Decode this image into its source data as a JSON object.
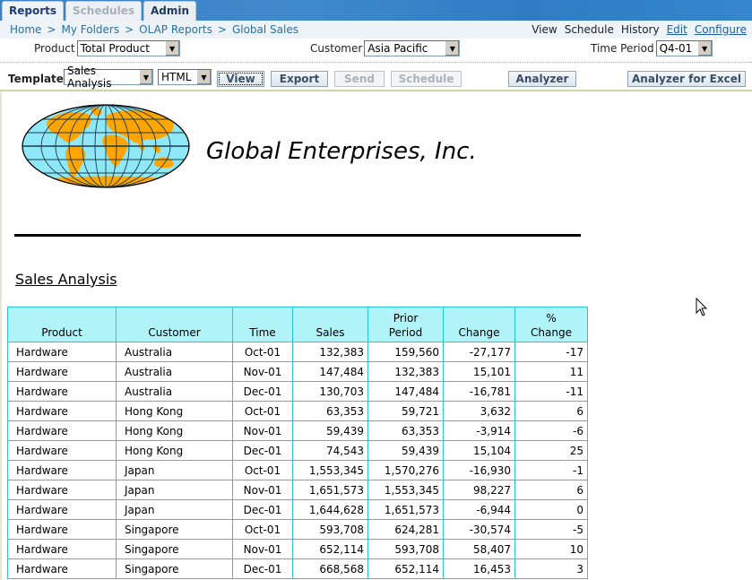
{
  "tabs": [
    {
      "label": "Reports",
      "state": "active"
    },
    {
      "label": "Schedules",
      "state": "inactive"
    },
    {
      "label": "Admin",
      "state": "normal"
    }
  ],
  "breadcrumb": [
    "Home",
    "My Folders",
    "OLAP Reports",
    "Global Sales"
  ],
  "breadcrumb_sep": ">",
  "actions": {
    "view": "View",
    "schedule": "Schedule",
    "history": "History",
    "edit": "Edit",
    "configure": "Configure"
  },
  "params": {
    "product": {
      "label": "Product",
      "value": "Total Product"
    },
    "customer": {
      "label": "Customer",
      "value": "Asia Pacific"
    },
    "time_period": {
      "label": "Time Period",
      "value": "Q4-01"
    }
  },
  "toolbar": {
    "template_label": "Template",
    "template_value": "Sales Analysis",
    "format_value": "HTML",
    "view": "View",
    "export": "Export",
    "send": "Send",
    "schedule": "Schedule",
    "analyzer": "Analyzer",
    "analyzer_excel": "Analyzer for Excel"
  },
  "report": {
    "company": "Global Enterprises, Inc.",
    "title": "Sales Analysis",
    "logo_icon": "globe-icon",
    "colors": {
      "header_bg": "#b0f4fa",
      "border": "#22c8e0",
      "logo_land": "#ffa500",
      "logo_ocean": "#8ee8f8"
    },
    "columns": [
      "Product",
      "Customer",
      "Time",
      "Sales",
      "Prior Period",
      "Change",
      "% Change"
    ],
    "rows": [
      [
        "Hardware",
        "Australia",
        "Oct-01",
        "132,383",
        "159,560",
        "-27,177",
        "-17"
      ],
      [
        "Hardware",
        "Australia",
        "Nov-01",
        "147,484",
        "132,383",
        "15,101",
        "11"
      ],
      [
        "Hardware",
        "Australia",
        "Dec-01",
        "130,703",
        "147,484",
        "-16,781",
        "-11"
      ],
      [
        "Hardware",
        "Hong Kong",
        "Oct-01",
        "63,353",
        "59,721",
        "3,632",
        "6"
      ],
      [
        "Hardware",
        "Hong Kong",
        "Nov-01",
        "59,439",
        "63,353",
        "-3,914",
        "-6"
      ],
      [
        "Hardware",
        "Hong Kong",
        "Dec-01",
        "74,543",
        "59,439",
        "15,104",
        "25"
      ],
      [
        "Hardware",
        "Japan",
        "Oct-01",
        "1,553,345",
        "1,570,276",
        "-16,930",
        "-1"
      ],
      [
        "Hardware",
        "Japan",
        "Nov-01",
        "1,651,573",
        "1,553,345",
        "98,227",
        "6"
      ],
      [
        "Hardware",
        "Japan",
        "Dec-01",
        "1,644,628",
        "1,651,573",
        "-6,944",
        "0"
      ],
      [
        "Hardware",
        "Singapore",
        "Oct-01",
        "593,708",
        "624,281",
        "-30,574",
        "-5"
      ],
      [
        "Hardware",
        "Singapore",
        "Nov-01",
        "652,114",
        "593,708",
        "58,407",
        "10"
      ],
      [
        "Hardware",
        "Singapore",
        "Dec-01",
        "668,568",
        "652,114",
        "16,453",
        "3"
      ]
    ]
  }
}
